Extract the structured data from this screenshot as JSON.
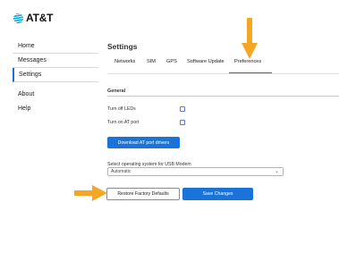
{
  "brand": {
    "name": "AT&T"
  },
  "sidebar": {
    "items": [
      {
        "label": "Home"
      },
      {
        "label": "Messages"
      },
      {
        "label": "Settings"
      },
      {
        "label": "About"
      },
      {
        "label": "Help"
      }
    ],
    "active_item": "Settings"
  },
  "main": {
    "title": "Settings",
    "tabs": [
      {
        "label": "Networks"
      },
      {
        "label": "SIM"
      },
      {
        "label": "GPS"
      },
      {
        "label": "Software Update"
      },
      {
        "label": "Preferences"
      }
    ],
    "active_tab": "Preferences",
    "section_title": "General",
    "checkboxes": [
      {
        "label": "Turn off LEDs",
        "checked": false
      },
      {
        "label": "Turn on AT port",
        "checked": false
      }
    ],
    "download_button": "Download AT port drivers",
    "os_select": {
      "label": "Select operating system for USB Modem",
      "value": "Automatic"
    },
    "restore_button": "Restore Factory Defaults",
    "save_button": "Save Changes"
  },
  "colors": {
    "accent": "#1a73d9",
    "annotation_arrow": "#f5a623",
    "brand_globe": "#00a8e0"
  },
  "icons": [
    "att-globe-icon",
    "chevron-down-icon",
    "annotation-arrow-down",
    "annotation-arrow-right"
  ]
}
